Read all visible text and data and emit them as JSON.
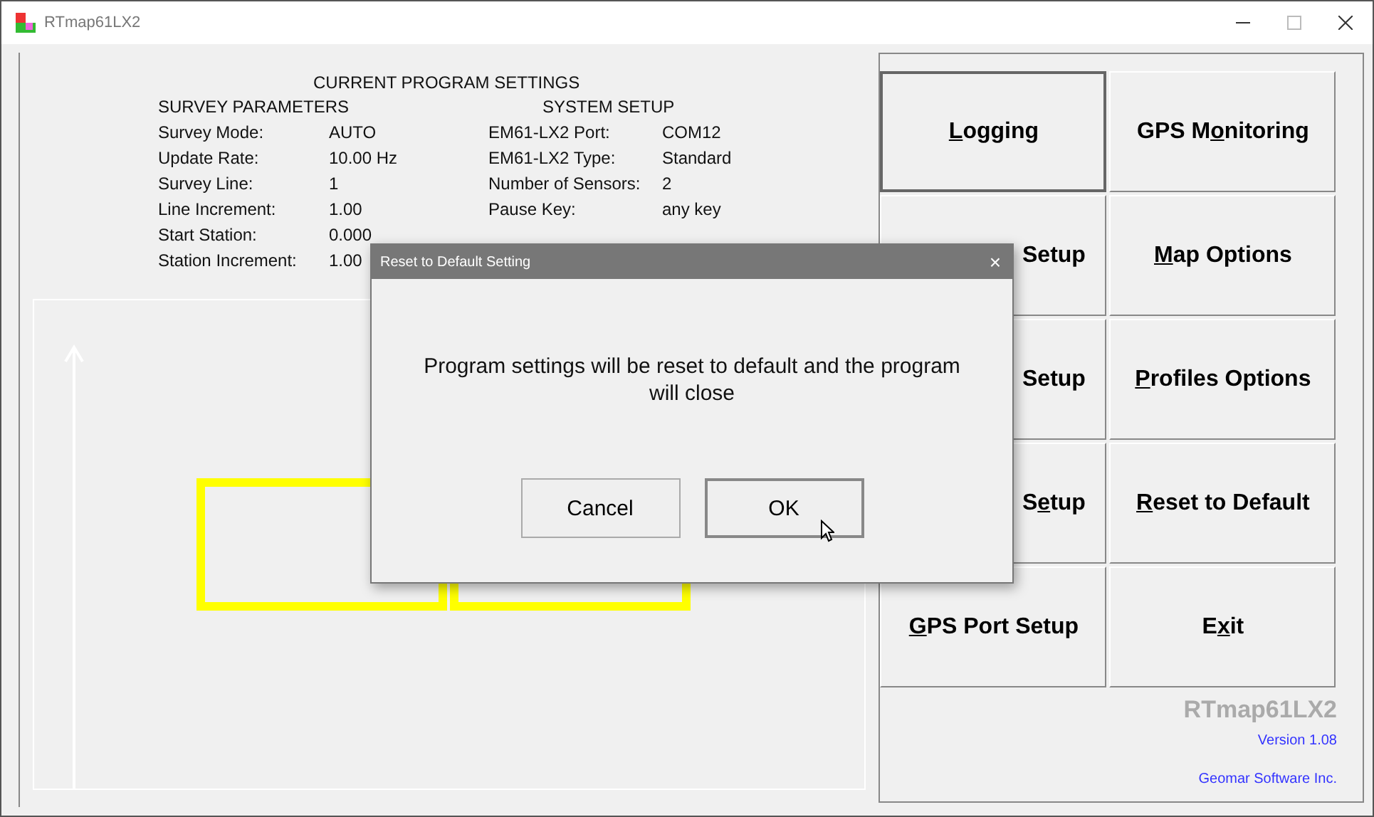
{
  "window": {
    "title": "RTmap61LX2"
  },
  "settings": {
    "heading": "CURRENT PROGRAM SETTINGS",
    "survey": {
      "heading": "SURVEY PARAMETERS",
      "rows": [
        {
          "label": "Survey Mode:",
          "value": "AUTO"
        },
        {
          "label": "Update Rate:",
          "value": "10.00 Hz"
        },
        {
          "label": "Survey Line:",
          "value": "1"
        },
        {
          "label": "Line Increment:",
          "value": "1.00"
        },
        {
          "label": "Start Station:",
          "value": "0.000"
        },
        {
          "label": "Station Increment:",
          "value": "1.00"
        }
      ]
    },
    "system": {
      "heading": "SYSTEM SETUP",
      "rows": [
        {
          "label": "EM61-LX2 Port:",
          "value": "COM12"
        },
        {
          "label": "EM61-LX2 Type:",
          "value": "Standard"
        },
        {
          "label": "Number of Sensors:",
          "value": "2"
        },
        {
          "label": "Pause Key:",
          "value": "any key"
        }
      ]
    }
  },
  "buttons": [
    {
      "parts": [
        {
          "text": "L",
          "underlined": true
        },
        {
          "text": "ogging",
          "underlined": false
        }
      ],
      "kind": "full",
      "pressed": true
    },
    {
      "parts": [
        {
          "text": "GPS M",
          "underlined": false
        },
        {
          "text": "o",
          "underlined": true
        },
        {
          "text": "nitoring",
          "underlined": false
        }
      ],
      "kind": "full",
      "pressed": false
    },
    {
      "parts": [
        {
          "text": "Setup",
          "underlined": false
        }
      ],
      "kind": "partly_hidden",
      "pressed": false
    },
    {
      "parts": [
        {
          "text": "M",
          "underlined": true
        },
        {
          "text": "ap Options",
          "underlined": false
        }
      ],
      "kind": "full",
      "pressed": false
    },
    {
      "parts": [
        {
          "text": "Setup",
          "underlined": false
        }
      ],
      "kind": "partly_hidden",
      "pressed": false
    },
    {
      "parts": [
        {
          "text": "P",
          "underlined": true
        },
        {
          "text": "rofiles Options",
          "underlined": false
        }
      ],
      "kind": "full",
      "pressed": false
    },
    {
      "parts": [
        {
          "text": "S",
          "underlined": false
        },
        {
          "text": "e",
          "underlined": true
        },
        {
          "text": "tup",
          "underlined": false
        }
      ],
      "kind": "partly_hidden",
      "pressed": false
    },
    {
      "parts": [
        {
          "text": "R",
          "underlined": true
        },
        {
          "text": "eset to Default",
          "underlined": false
        }
      ],
      "kind": "full",
      "pressed": false
    },
    {
      "parts": [
        {
          "text": "G",
          "underlined": true
        },
        {
          "text": "PS Port Setup",
          "underlined": false
        }
      ],
      "kind": "full",
      "pressed": false
    },
    {
      "parts": [
        {
          "text": "E",
          "underlined": false
        },
        {
          "text": "x",
          "underlined": true
        },
        {
          "text": "it",
          "underlined": false
        }
      ],
      "kind": "full",
      "pressed": false
    }
  ],
  "about": {
    "product": "RTmap61LX2",
    "version": "Version 1.08",
    "company": "Geomar Software Inc."
  },
  "dialog": {
    "title": "Reset to Default Setting",
    "close": "×",
    "message": "Program settings will be reset to default and the program will close",
    "buttons": [
      {
        "label": "Cancel",
        "focused": false
      },
      {
        "label": "OK",
        "focused": true
      }
    ]
  }
}
